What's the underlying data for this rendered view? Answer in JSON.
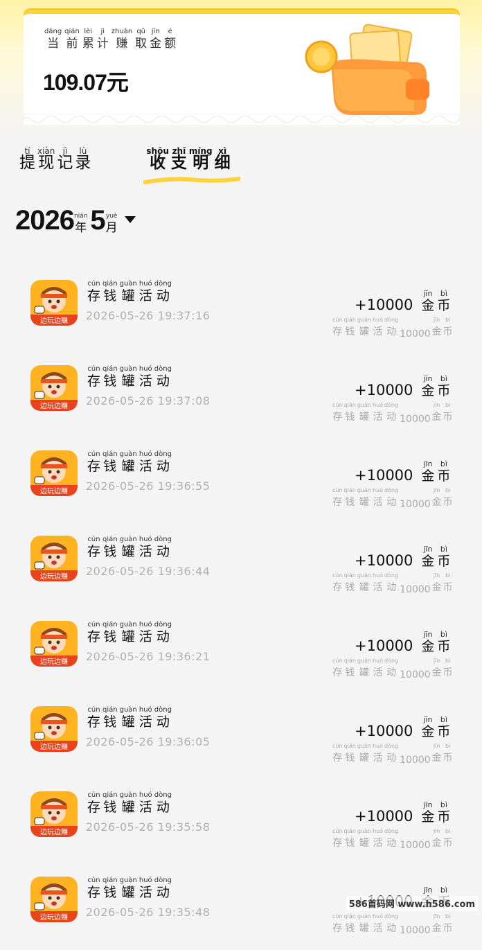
{
  "colors": {
    "accent": "#ffd23a",
    "background": "#f4f4f4",
    "muted": "#b0b0b0"
  },
  "card": {
    "label": [
      {
        "ch": "当",
        "py": "dāng"
      },
      {
        "ch": "前",
        "py": "qián"
      },
      {
        "ch": "累",
        "py": "lèi"
      },
      {
        "ch": "计",
        "py": "jì"
      },
      {
        "ch": "赚",
        "py": "zhuàn"
      },
      {
        "ch": "取",
        "py": "qǔ"
      },
      {
        "ch": "金",
        "py": "jīn"
      },
      {
        "ch": "额",
        "py": "é"
      }
    ],
    "balance": "109.07元",
    "illustration": "wallet-coins-icon"
  },
  "tabs": [
    {
      "name": "withdraw",
      "chars": [
        {
          "ch": "提",
          "py": "tí"
        },
        {
          "ch": "现",
          "py": "xiàn"
        },
        {
          "ch": "记",
          "py": "jì"
        },
        {
          "ch": "录",
          "py": "lù"
        }
      ],
      "active": false
    },
    {
      "name": "income",
      "chars": [
        {
          "ch": "收",
          "py": "shōu"
        },
        {
          "ch": "支",
          "py": "zhī"
        },
        {
          "ch": "明",
          "py": "míng"
        },
        {
          "ch": "细",
          "py": "xì"
        }
      ],
      "active": true
    }
  ],
  "date": {
    "year": "2026",
    "year_unit": {
      "ch": "年",
      "py": "nián"
    },
    "month": "5",
    "month_unit": {
      "ch": "月",
      "py": "yuè"
    },
    "icon": "caret-down-icon"
  },
  "transactions": [
    {
      "title": [
        {
          "ch": "存",
          "py": "cún"
        },
        {
          "ch": "钱",
          "py": "qián"
        },
        {
          "ch": "罐",
          "py": "guàn"
        },
        {
          "ch": "活",
          "py": "huó"
        },
        {
          "ch": "动",
          "py": "dòng"
        }
      ],
      "time": "2026-05-26 19:37:16",
      "amount": "+10000",
      "unit": [
        {
          "ch": "金",
          "py": "jīn"
        },
        {
          "ch": "币",
          "py": "bì"
        }
      ],
      "note_num": "10000"
    },
    {
      "title": [
        {
          "ch": "存",
          "py": "cún"
        },
        {
          "ch": "钱",
          "py": "qián"
        },
        {
          "ch": "罐",
          "py": "guàn"
        },
        {
          "ch": "活",
          "py": "huó"
        },
        {
          "ch": "动",
          "py": "dòng"
        }
      ],
      "time": "2026-05-26 19:37:08",
      "amount": "+10000",
      "unit": [
        {
          "ch": "金",
          "py": "jīn"
        },
        {
          "ch": "币",
          "py": "bì"
        }
      ],
      "note_num": "10000"
    },
    {
      "title": [
        {
          "ch": "存",
          "py": "cún"
        },
        {
          "ch": "钱",
          "py": "qián"
        },
        {
          "ch": "罐",
          "py": "guàn"
        },
        {
          "ch": "活",
          "py": "huó"
        },
        {
          "ch": "动",
          "py": "dòng"
        }
      ],
      "time": "2026-05-26 19:36:55",
      "amount": "+10000",
      "unit": [
        {
          "ch": "金",
          "py": "jīn"
        },
        {
          "ch": "币",
          "py": "bì"
        }
      ],
      "note_num": "10000"
    },
    {
      "title": [
        {
          "ch": "存",
          "py": "cún"
        },
        {
          "ch": "钱",
          "py": "qián"
        },
        {
          "ch": "罐",
          "py": "guàn"
        },
        {
          "ch": "活",
          "py": "huó"
        },
        {
          "ch": "动",
          "py": "dòng"
        }
      ],
      "time": "2026-05-26 19:36:44",
      "amount": "+10000",
      "unit": [
        {
          "ch": "金",
          "py": "jīn"
        },
        {
          "ch": "币",
          "py": "bì"
        }
      ],
      "note_num": "10000"
    },
    {
      "title": [
        {
          "ch": "存",
          "py": "cún"
        },
        {
          "ch": "钱",
          "py": "qián"
        },
        {
          "ch": "罐",
          "py": "guàn"
        },
        {
          "ch": "活",
          "py": "huó"
        },
        {
          "ch": "动",
          "py": "dòng"
        }
      ],
      "time": "2026-05-26 19:36:21",
      "amount": "+10000",
      "unit": [
        {
          "ch": "金",
          "py": "jīn"
        },
        {
          "ch": "币",
          "py": "bì"
        }
      ],
      "note_num": "10000"
    },
    {
      "title": [
        {
          "ch": "存",
          "py": "cún"
        },
        {
          "ch": "钱",
          "py": "qián"
        },
        {
          "ch": "罐",
          "py": "guàn"
        },
        {
          "ch": "活",
          "py": "huó"
        },
        {
          "ch": "动",
          "py": "dòng"
        }
      ],
      "time": "2026-05-26 19:36:05",
      "amount": "+10000",
      "unit": [
        {
          "ch": "金",
          "py": "jīn"
        },
        {
          "ch": "币",
          "py": "bì"
        }
      ],
      "note_num": "10000"
    },
    {
      "title": [
        {
          "ch": "存",
          "py": "cún"
        },
        {
          "ch": "钱",
          "py": "qián"
        },
        {
          "ch": "罐",
          "py": "guàn"
        },
        {
          "ch": "活",
          "py": "huó"
        },
        {
          "ch": "动",
          "py": "dòng"
        }
      ],
      "time": "2026-05-26 19:35:58",
      "amount": "+10000",
      "unit": [
        {
          "ch": "金",
          "py": "jīn"
        },
        {
          "ch": "币",
          "py": "bì"
        }
      ],
      "note_num": "10000"
    },
    {
      "title": [
        {
          "ch": "存",
          "py": "cún"
        },
        {
          "ch": "钱",
          "py": "qián"
        },
        {
          "ch": "罐",
          "py": "guàn"
        },
        {
          "ch": "活",
          "py": "huó"
        },
        {
          "ch": "动",
          "py": "dòng"
        }
      ],
      "time": "2026-05-26 19:35:48",
      "amount": "+10000",
      "unit": [
        {
          "ch": "金",
          "py": "jīn"
        },
        {
          "ch": "币",
          "py": "bì"
        }
      ],
      "note_num": "10000"
    }
  ],
  "app_icon_label": "边玩边赚",
  "watermark": "586首码网 www.h586.com"
}
